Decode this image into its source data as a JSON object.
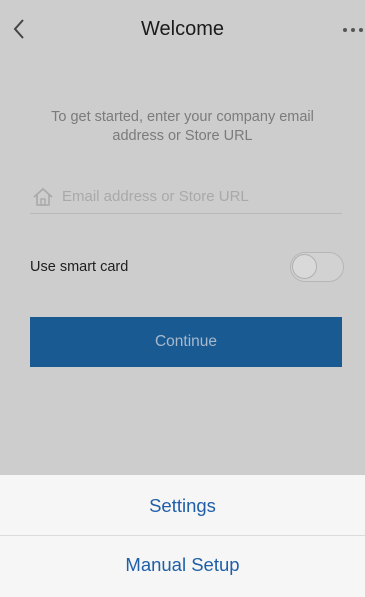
{
  "nav": {
    "title": "Welcome",
    "back_icon": "chevron-left-icon",
    "more_icon": "more-horizontal-icon"
  },
  "intro": {
    "text": "To get started, enter your company email address or Store URL"
  },
  "email_field": {
    "icon": "home-icon",
    "placeholder": "Email address or Store URL",
    "value": ""
  },
  "smart_card": {
    "label": "Use smart card",
    "enabled": false
  },
  "continue_button": {
    "label": "Continue"
  },
  "action_sheet": {
    "items": [
      {
        "label": "Settings"
      },
      {
        "label": "Manual Setup"
      }
    ]
  },
  "colors": {
    "primary": "#1a5a92",
    "link": "#1f5fa8",
    "background": "#cdcdcd"
  }
}
